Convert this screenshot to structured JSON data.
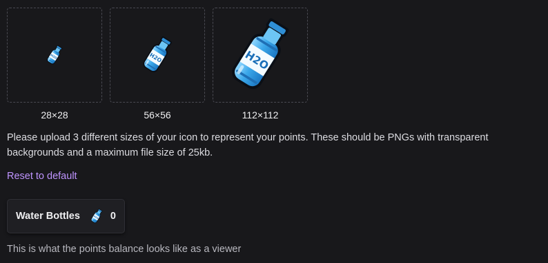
{
  "icons": [
    {
      "size_label": "28×28",
      "icon": "water-bottle-icon"
    },
    {
      "size_label": "56×56",
      "icon": "water-bottle-icon"
    },
    {
      "size_label": "112×112",
      "icon": "water-bottle-icon"
    }
  ],
  "description": "Please upload 3 different sizes of your icon to represent your points. These should be PNGs with transparent backgrounds and a maximum file size of 25kb.",
  "reset_link": "Reset to default",
  "balance": {
    "name": "Water Bottles",
    "value": "0",
    "icon": "water-bottle-icon"
  },
  "viewer_note": "This is what the points balance looks like as a viewer",
  "colors": {
    "background": "#18181b",
    "link": "#bf94ff",
    "bottle_blue": "#3fa9e8",
    "bottle_dark": "#0e3a5c"
  }
}
